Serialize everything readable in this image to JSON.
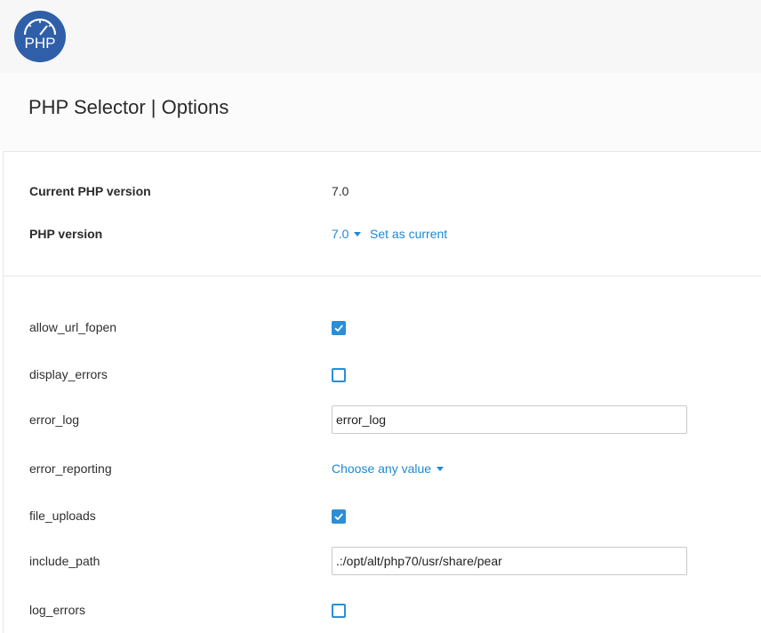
{
  "header": {
    "logo_text": "PHP"
  },
  "page": {
    "title": "PHP Selector | Options"
  },
  "versions": {
    "current_label": "Current PHP version",
    "current_value": "7.0",
    "version_label": "PHP version",
    "version_selected": "7.0",
    "set_current_label": "Set as current"
  },
  "options": {
    "allow_url_fopen": {
      "label": "allow_url_fopen",
      "checked": true
    },
    "display_errors": {
      "label": "display_errors",
      "checked": false
    },
    "error_log": {
      "label": "error_log",
      "value": "error_log"
    },
    "error_reporting": {
      "label": "error_reporting",
      "value": "Choose any value"
    },
    "file_uploads": {
      "label": "file_uploads",
      "checked": true
    },
    "include_path": {
      "label": "include_path",
      "value": ".:/opt/alt/php70/usr/share/pear"
    },
    "log_errors": {
      "label": "log_errors",
      "checked": false
    }
  },
  "colors": {
    "accent": "#1e88d3",
    "checkbox": "#2c8ed6",
    "logo_bg": "#2f5fa8"
  }
}
